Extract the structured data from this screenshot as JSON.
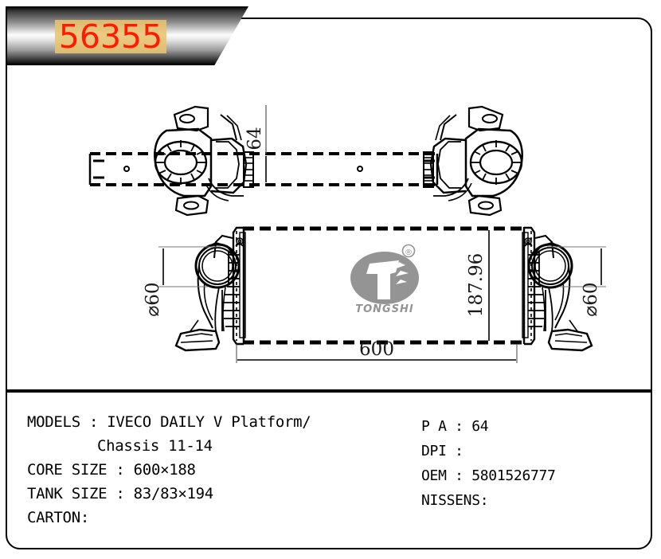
{
  "header": {
    "part_number": "56355"
  },
  "drawing": {
    "watermark": {
      "brand": "TONGSHI",
      "registered_symbol": "®",
      "color": "#949494"
    },
    "dimensions": {
      "top_view_depth": "64",
      "core_height": "187.96",
      "core_width": "600",
      "left_port_diameter": "⌀60",
      "right_port_diameter": "⌀60"
    }
  },
  "spec": {
    "left": [
      {
        "label": "MODELS",
        "sep": " : ",
        "value": "IVECO DAILY V Platform/",
        "line1": "MODELS : IVECO DAILY V Platform/"
      },
      {
        "line2": "Chassis 11-14"
      },
      {
        "label": "CORE SIZE",
        "sep": " : ",
        "value": "600×188",
        "line3": "CORE SIZE : 600×188"
      },
      {
        "label": "TANK SIZE",
        "sep": " : ",
        "value": "83/83×194",
        "line4": "TANK SIZE : 83/83×194"
      },
      {
        "label": "CARTON",
        "sep": ":",
        "value": "",
        "line5": "CARTON:"
      }
    ],
    "left_lines": [
      "MODELS : IVECO DAILY V Platform/",
      "Chassis 11-14",
      "CORE SIZE : 600×188",
      "TANK SIZE : 83/83×194",
      "CARTON:"
    ],
    "right_lines": [
      "P A : 64",
      "DPI :",
      "OEM : 5801526777",
      "NISSENS:"
    ]
  }
}
